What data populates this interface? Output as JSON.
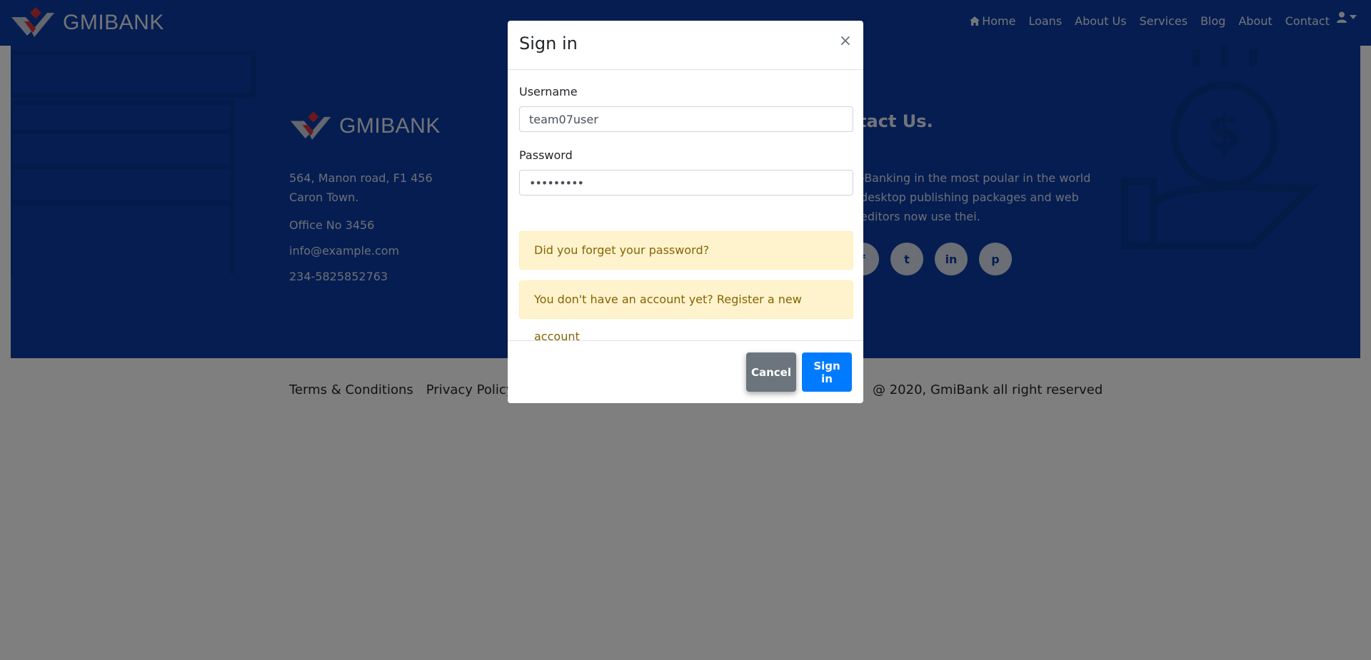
{
  "brand": {
    "name": "GMIBANK"
  },
  "nav": {
    "items": [
      "Home",
      "Loans",
      "About Us",
      "Services",
      "Blog",
      "About",
      "Contact"
    ]
  },
  "footer": {
    "address": "564, Manon road, F1 456 Caron Town.",
    "office": "Office No 3456",
    "email": "info@example.com",
    "phone": "234-5825852763",
    "contact_title": "ntact Us.",
    "contact_text": "-Banking in the most poular in the world desktop publishing packages and web editors now use thei.",
    "social_icons": [
      "facebook-icon",
      "twitter-icon",
      "linkedin-icon",
      "pinterest-icon"
    ]
  },
  "bottom": {
    "terms": "Terms & Conditions",
    "privacy": "Privacy Policy",
    "copyright": "@ 2020, GmiBank all right reserved"
  },
  "modal": {
    "title": "Sign in",
    "close": "×",
    "username_label": "Username",
    "username_value": "team07user",
    "password_label": "Password",
    "password_value": "•••••••••",
    "forgot_password": "Did you forget your password?",
    "register": "You don't have an account yet? Register a new account",
    "cancel": "Cancel",
    "sign_in": "Sign in"
  },
  "colors": {
    "navbar": "#0b3aa3",
    "primary_button": "#007bff",
    "secondary_button": "#6c757d",
    "alert_bg": "#fff3cd",
    "alert_text": "#856404"
  }
}
